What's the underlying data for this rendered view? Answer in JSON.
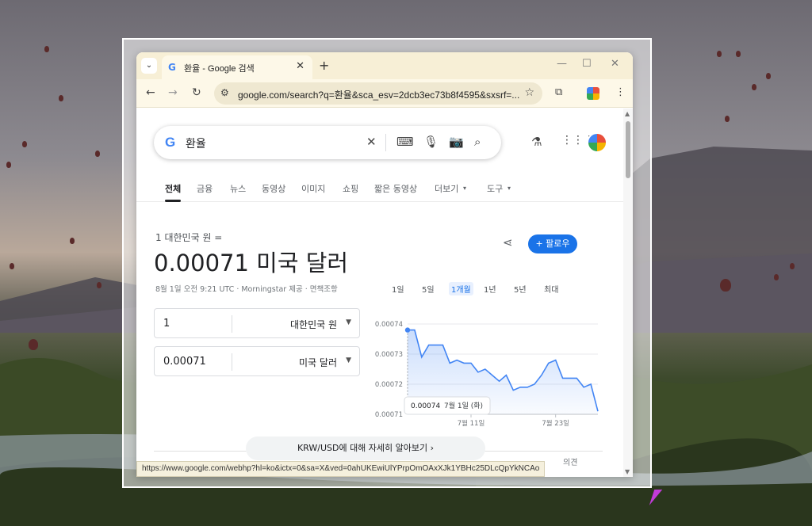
{
  "browser": {
    "tab": {
      "title": "환율 - Google 검색",
      "favicon": "G"
    },
    "new_tab_label": "+",
    "url": "google.com/search?q=환율&sca_esv=2dcb3ec73b8f4595&sxsrf=...",
    "status_url": "https://www.google.com/webhp?hl=ko&ictx=0&sa=X&ved=0ahUKEwiUlYPrpOmOAxXJk1YBHc25DLcQpYkNCAo"
  },
  "search": {
    "query": "환율",
    "logo": "G"
  },
  "nav_tabs": [
    "전체",
    "금융",
    "뉴스",
    "동영상",
    "이미지",
    "쇼핑",
    "짧은 동영상",
    "더보기",
    "도구"
  ],
  "converter": {
    "from_line": "1 대한민국 원 =",
    "rate_text": "0.00071 미국 달러",
    "meta": "8월 1일 오전 9:21 UTC · Morningstar 제공 · 면책조항",
    "follow_label": "+ 팔로우",
    "row1": {
      "amount": "1",
      "currency": "대한민국 원"
    },
    "row2": {
      "amount": "0.00071",
      "currency": "미국 달러"
    },
    "learn_more": "KRW/USD에 대해 자세히 알아보기  ›",
    "feedback": "의견"
  },
  "ranges": [
    "1일",
    "5일",
    "1개월",
    "1년",
    "5년",
    "최대"
  ],
  "active_range": "1개월",
  "chart_data": {
    "type": "area",
    "y_ticks": [
      "0.00074",
      "0.00073",
      "0.00072",
      "0.00071"
    ],
    "ylim": [
      0.00071,
      0.00074
    ],
    "x_ticks": [
      "7월 11일",
      "7월 23일"
    ],
    "x_tick_index": [
      9,
      21
    ],
    "tooltip": {
      "value": "0.00074",
      "date": "7월 1일 (화)"
    },
    "values": [
      0.000738,
      0.000738,
      0.000729,
      0.000733,
      0.000733,
      0.000733,
      0.000727,
      0.000728,
      0.000727,
      0.000727,
      0.000724,
      0.000725,
      0.000723,
      0.000721,
      0.000723,
      0.000718,
      0.000719,
      0.000719,
      0.00072,
      0.000723,
      0.000727,
      0.000728,
      0.000722,
      0.000722,
      0.000722,
      0.000719,
      0.00072,
      0.000711
    ],
    "line_color": "#4285f4"
  }
}
